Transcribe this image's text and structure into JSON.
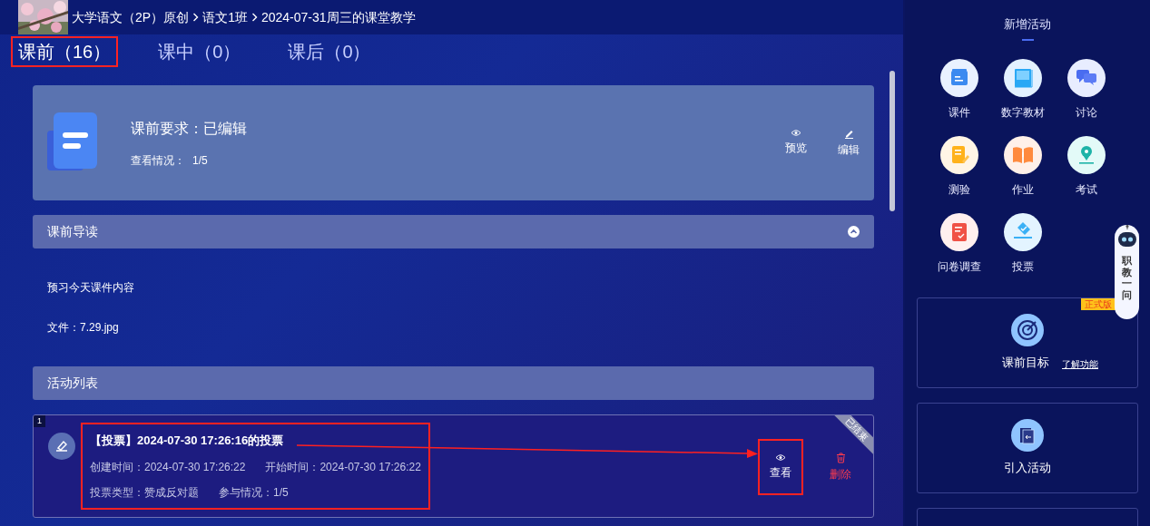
{
  "breadcrumb": [
    "大学语文（2P）原创",
    "语文1班",
    "2024-07-31周三的课堂教学"
  ],
  "tabs": [
    {
      "label": "课前（16）",
      "selected": true,
      "highlighted": true
    },
    {
      "label": "课中（0）",
      "selected": false,
      "highlighted": false
    },
    {
      "label": "课后（0）",
      "selected": false,
      "highlighted": false
    }
  ],
  "requirement": {
    "title": "课前要求：已编辑",
    "view_label": "查看情况：",
    "view_value": "1/5",
    "actions": [
      {
        "kind": "preview",
        "label": "预览"
      },
      {
        "kind": "edit",
        "label": "编辑"
      }
    ]
  },
  "guide": {
    "title": "课前导读",
    "expanded": true,
    "text": "预习今天课件内容",
    "file_label": "文件：",
    "file_name": "7.29.jpg"
  },
  "activity_list": {
    "title": "活动列表",
    "items": [
      {
        "index": "1",
        "title": "【投票】2024-07-30 17:26:16的投票",
        "status": "已结束",
        "highlighted": true,
        "fields": [
          [
            {
              "label": "创建时间：",
              "value": "2024-07-30 17:26:22"
            },
            {
              "label": "开始时间：",
              "value": "2024-07-30 17:26:22"
            }
          ],
          [
            {
              "label": "投票类型：",
              "value": "赞成反对题"
            },
            {
              "label": "参与情况：",
              "value": "1/5"
            }
          ]
        ],
        "actions": [
          {
            "kind": "view",
            "label": "查看",
            "highlighted": true
          },
          {
            "kind": "delete",
            "label": "删除",
            "highlighted": false
          }
        ]
      }
    ]
  },
  "sidebar": {
    "title": "新增活动",
    "activities": [
      {
        "kind": "courseware",
        "label": "课件"
      },
      {
        "kind": "textbook",
        "label": "数字教材"
      },
      {
        "kind": "discussion",
        "label": "讨论"
      },
      {
        "kind": "quiz",
        "label": "测验"
      },
      {
        "kind": "homework",
        "label": "作业"
      },
      {
        "kind": "exam",
        "label": "考试"
      },
      {
        "kind": "survey",
        "label": "问卷调查"
      },
      {
        "kind": "vote",
        "label": "投票"
      }
    ],
    "goal": {
      "label": "课前目标",
      "link": "了解功能",
      "badge": "正式版"
    },
    "import": {
      "label": "引入活动"
    }
  },
  "assistant": {
    "label": "职教一问"
  }
}
